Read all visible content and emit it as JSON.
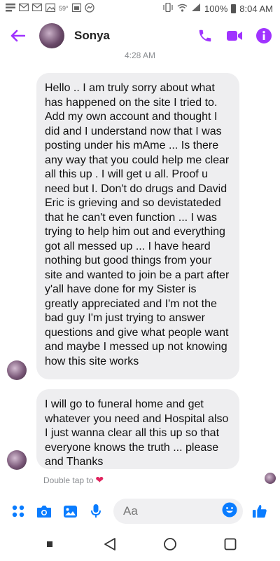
{
  "status_bar": {
    "temperature": "59°",
    "battery_percent": "100%",
    "time": "8:04 AM",
    "icons": [
      "notification-icon",
      "gmail-icon",
      "gmail-icon",
      "image-icon",
      "weather-icon",
      "calendar-icon",
      "messenger-icon",
      "vibrate-icon",
      "wifi-icon",
      "lte-signal-icon",
      "battery-icon"
    ]
  },
  "header": {
    "contact_name": "Sonya",
    "accent_color": "#a033ff",
    "icons": [
      "back-arrow-icon",
      "phone-icon",
      "video-camera-icon",
      "info-icon"
    ]
  },
  "timestamp": "4:28 AM",
  "messages": [
    {
      "text": "Hello .. I am truly sorry about what has happened on the site I tried to. Add my own account and thought I did and I understand now that I was posting under his mAme ... Is there any way that you could help me clear all this up . I will get u all. Proof u need but I. Don't do drugs and David Eric is grieving and so devistateded that  he can't even function ... I was trying to help him out and everything got all messed up ... I have heard nothing but good things from your site and wanted to join be a part after y'all have done for my Sister is greatly appreciated and I'm not the bad guy I'm just trying to answer questions and give what people want and maybe I messed up not knowing how this site works"
    },
    {
      "text": "I will go to funeral home and get whatever you need and Hospital also I just wanna clear all this up so that everyone knows the truth ... please and Thanks"
    }
  ],
  "double_tap_hint": "Double tap to",
  "composer": {
    "placeholder": "Aa",
    "accent_color": "#0a7cff",
    "icons": [
      "menu-dots-icon",
      "camera-icon",
      "gallery-icon",
      "microphone-icon",
      "emoji-icon",
      "thumbs-up-icon"
    ]
  },
  "nav": {
    "icons": [
      "recents-square-icon",
      "back-triangle-icon",
      "home-circle-icon",
      "overview-square-icon"
    ]
  }
}
